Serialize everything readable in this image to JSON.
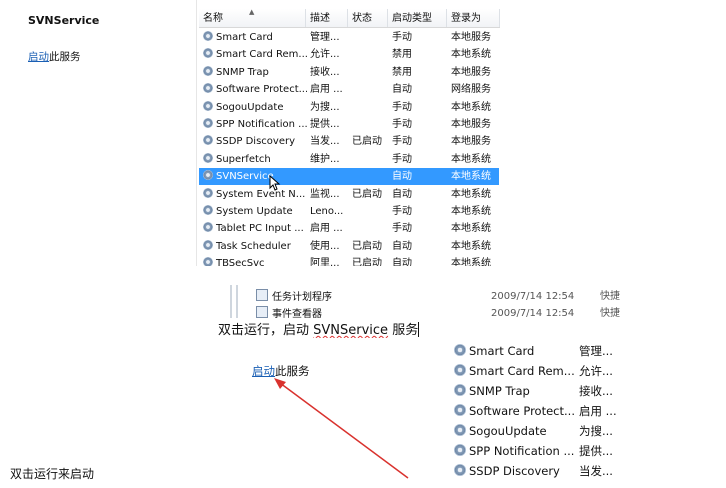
{
  "top": {
    "title": "SVNService",
    "start_link": "启动",
    "start_suffix": "此服务",
    "columns": [
      "名称",
      "描述",
      "状态",
      "启动类型",
      "登录为"
    ],
    "rows": [
      {
        "name": "Smart Card",
        "desc": "管理...",
        "status": "",
        "startup": "手动",
        "logon": "本地服务"
      },
      {
        "name": "Smart Card Rem...",
        "desc": "允许...",
        "status": "",
        "startup": "禁用",
        "logon": "本地系统"
      },
      {
        "name": "SNMP Trap",
        "desc": "接收...",
        "status": "",
        "startup": "禁用",
        "logon": "本地服务"
      },
      {
        "name": "Software Protect...",
        "desc": "启用 ...",
        "status": "",
        "startup": "自动",
        "logon": "网络服务"
      },
      {
        "name": "SogouUpdate",
        "desc": "为搜...",
        "status": "",
        "startup": "手动",
        "logon": "本地系统"
      },
      {
        "name": "SPP Notification ...",
        "desc": "提供...",
        "status": "",
        "startup": "手动",
        "logon": "本地服务"
      },
      {
        "name": "SSDP Discovery",
        "desc": "当发...",
        "status": "已启动",
        "startup": "手动",
        "logon": "本地服务"
      },
      {
        "name": "Superfetch",
        "desc": "维护...",
        "status": "",
        "startup": "手动",
        "logon": "本地系统"
      },
      {
        "name": "SVNService",
        "desc": "",
        "status": "",
        "startup": "自动",
        "logon": "本地系统",
        "selected": true
      },
      {
        "name": "System Event N...",
        "desc": "监视...",
        "status": "已启动",
        "startup": "自动",
        "logon": "本地系统"
      },
      {
        "name": "System Update",
        "desc": "Leno...",
        "status": "",
        "startup": "手动",
        "logon": "本地系统"
      },
      {
        "name": "Tablet PC Input ...",
        "desc": "启用 ...",
        "status": "",
        "startup": "手动",
        "logon": "本地系统"
      },
      {
        "name": "Task Scheduler",
        "desc": "使用...",
        "status": "已启动",
        "startup": "自动",
        "logon": "本地系统"
      },
      {
        "name": "TBSecSvc",
        "desc": "阿里...",
        "status": "已启动",
        "startup": "自动",
        "logon": "本地系统"
      }
    ]
  },
  "middle": {
    "row1": {
      "name": "任务计划程序",
      "date": "2009/7/14 12:54",
      "type": "快捷"
    },
    "row2": {
      "name": "事件查看器",
      "date": "2009/7/14 12:54",
      "type": "快捷"
    }
  },
  "caption": {
    "prefix": "双击运行，启动 ",
    "service": "SVNService",
    "suffix": " 服务"
  },
  "bottom": {
    "start_link": "启动",
    "start_suffix": "此服务",
    "rows": [
      {
        "name": "Smart Card",
        "desc": "管理..."
      },
      {
        "name": "Smart Card Rem...",
        "desc": "允许..."
      },
      {
        "name": "SNMP Trap",
        "desc": "接收..."
      },
      {
        "name": "Software Protect...",
        "desc": "启用 ..."
      },
      {
        "name": "SogouUpdate",
        "desc": "为搜..."
      },
      {
        "name": "SPP Notification ...",
        "desc": "提供..."
      },
      {
        "name": "SSDP Discovery",
        "desc": "当发..."
      }
    ]
  },
  "note": "双击运行来启动",
  "colors": {
    "selection": "#3399ff",
    "link": "#1a5fb4",
    "arrow": "#d9322e"
  },
  "icons": [
    "service-gear-icon",
    "task-scheduler-icon",
    "event-viewer-icon",
    "mouse-cursor-icon",
    "sort-arrow-icon"
  ]
}
